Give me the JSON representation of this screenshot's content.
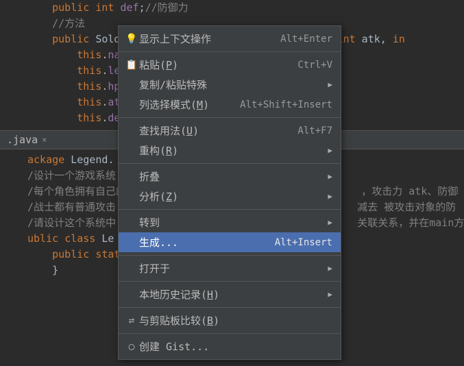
{
  "code_top": [
    {
      "indent": 1,
      "tokens": [
        {
          "t": "public",
          "c": "kw"
        },
        {
          "t": " ",
          "c": ""
        },
        {
          "t": "int",
          "c": "kw"
        },
        {
          "t": " ",
          "c": ""
        },
        {
          "t": "def",
          "c": "field"
        },
        {
          "t": ";",
          "c": ""
        },
        {
          "t": "//防御力",
          "c": "comment"
        }
      ]
    },
    {
      "indent": 1,
      "tokens": [
        {
          "t": "//方法",
          "c": "comment"
        }
      ]
    },
    {
      "indent": 1,
      "tokens": [
        {
          "t": "public",
          "c": "kw"
        },
        {
          "t": " Soldi                              hp, ",
          "c": "ident"
        },
        {
          "t": "int",
          "c": "kw"
        },
        {
          "t": " atk, ",
          "c": "ident"
        },
        {
          "t": "in",
          "c": "kw"
        }
      ]
    },
    {
      "indent": 2,
      "tokens": [
        {
          "t": "this",
          "c": "kw"
        },
        {
          "t": ".",
          "c": ""
        },
        {
          "t": "na",
          "c": "field"
        }
      ]
    },
    {
      "indent": 2,
      "tokens": [
        {
          "t": "this",
          "c": "kw"
        },
        {
          "t": ".",
          "c": ""
        },
        {
          "t": "le",
          "c": "field"
        }
      ]
    },
    {
      "indent": 2,
      "tokens": [
        {
          "t": "this",
          "c": "kw"
        },
        {
          "t": ".",
          "c": ""
        },
        {
          "t": "hp",
          "c": "field"
        }
      ]
    },
    {
      "indent": 2,
      "tokens": [
        {
          "t": "this",
          "c": "kw"
        },
        {
          "t": ".",
          "c": ""
        },
        {
          "t": "at",
          "c": "field"
        }
      ]
    },
    {
      "indent": 2,
      "tokens": [
        {
          "t": "this",
          "c": "kw"
        },
        {
          "t": ".",
          "c": ""
        },
        {
          "t": "de",
          "c": "field"
        }
      ]
    }
  ],
  "tab": {
    "label": ".java",
    "close": "×"
  },
  "code_bottom": [
    {
      "indent": 0,
      "tokens": [
        {
          "t": "ackage",
          "c": "kw"
        },
        {
          "t": " Legend.",
          "c": "ident"
        }
      ]
    },
    {
      "indent": 0,
      "tokens": [
        {
          "t": "/设计一个游戏系统",
          "c": "comment"
        }
      ]
    },
    {
      "indent": 0,
      "tokens": [
        {
          "t": "/每个角色拥有自己的",
          "c": "comment"
        },
        {
          "t": "                                      ",
          "c": ""
        },
        {
          "t": "，攻击力 atk、防御",
          "c": "comment"
        }
      ]
    },
    {
      "indent": 0,
      "tokens": [
        {
          "t": "/战士都有普通攻击",
          "c": "comment"
        },
        {
          "t": "                                       ",
          "c": ""
        },
        {
          "t": "减去 被攻击对象的防",
          "c": "comment"
        }
      ]
    },
    {
      "indent": 0,
      "tokens": [
        {
          "t": "/请设计这个系统中",
          "c": "comment"
        },
        {
          "t": "                                       ",
          "c": ""
        },
        {
          "t": "关联关系，并在main方",
          "c": "comment"
        }
      ]
    },
    {
      "indent": 0,
      "tokens": [
        {
          "t": "ublic",
          "c": "kw"
        },
        {
          "t": " ",
          "c": ""
        },
        {
          "t": "class",
          "c": "kw"
        },
        {
          "t": " Le",
          "c": "ident"
        }
      ]
    },
    {
      "indent": 1,
      "tokens": [
        {
          "t": "public",
          "c": "kw"
        },
        {
          "t": " ",
          "c": ""
        },
        {
          "t": "stat",
          "c": "kw"
        }
      ]
    },
    {
      "indent": 1,
      "tokens": [
        {
          "t": "}",
          "c": ""
        }
      ]
    }
  ],
  "menu": [
    {
      "icon": "💡",
      "label": "显示上下文操作",
      "shortcut": "Alt+Enter"
    },
    {
      "sep": true
    },
    {
      "icon": "📋",
      "label": "粘贴(",
      "u": "P",
      "label2": ")",
      "shortcut": "Ctrl+V"
    },
    {
      "icon": "",
      "label": "复制/粘贴特殊",
      "arrow": true
    },
    {
      "icon": "",
      "label": "列选择模式(",
      "u": "M",
      "label2": ")",
      "shortcut": "Alt+Shift+Insert"
    },
    {
      "sep": true
    },
    {
      "icon": "",
      "label": "查找用法(",
      "u": "U",
      "label2": ")",
      "shortcut": "Alt+F7"
    },
    {
      "icon": "",
      "label": "重构(",
      "u": "R",
      "label2": ")",
      "arrow": true
    },
    {
      "sep": true
    },
    {
      "icon": "",
      "label": "折叠",
      "arrow": true
    },
    {
      "icon": "",
      "label": "分析(",
      "u": "Z",
      "label2": ")",
      "arrow": true
    },
    {
      "sep": true
    },
    {
      "icon": "",
      "label": "转到",
      "arrow": true
    },
    {
      "icon": "",
      "label": "生成...",
      "shortcut": "Alt+Insert",
      "selected": true
    },
    {
      "sep": true
    },
    {
      "icon": "",
      "label": "打开于",
      "arrow": true
    },
    {
      "sep": true
    },
    {
      "icon": "",
      "label": "本地历史记录(",
      "u": "H",
      "label2": ")",
      "arrow": true
    },
    {
      "sep": true
    },
    {
      "icon": "⇄",
      "label": "与剪贴板比较(",
      "u": "B",
      "label2": ")"
    },
    {
      "sep": true
    },
    {
      "icon": "◯",
      "label": "创建 Gist..."
    }
  ]
}
